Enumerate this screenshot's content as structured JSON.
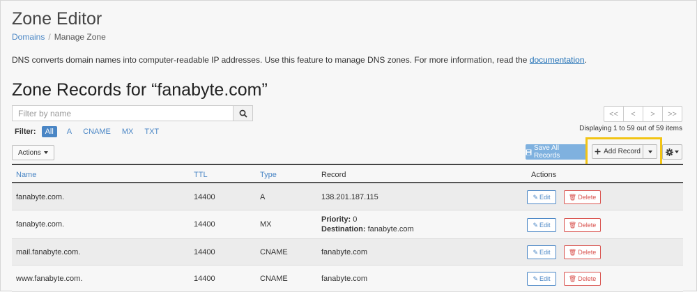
{
  "page_title": "Zone Editor",
  "breadcrumb": {
    "parent": "Domains",
    "separator": "/",
    "current": "Manage Zone"
  },
  "description": {
    "text": "DNS converts domain names into computer-readable IP addresses. Use this feature to manage DNS zones. For more information, read the ",
    "link": "documentation",
    "end": "."
  },
  "section_title": "Zone Records for “fanabyte.com”",
  "search": {
    "placeholder": "Filter by name"
  },
  "filter": {
    "label": "Filter:",
    "options": [
      "All",
      "A",
      "CNAME",
      "MX",
      "TXT"
    ],
    "active": "All"
  },
  "pagination": {
    "first": "<<",
    "prev": "<",
    "next": ">",
    "last": ">>",
    "display": "Displaying 1 to 59 out of 59 items"
  },
  "toolbar": {
    "actions_label": "Actions",
    "save_all_label": "Save All Records",
    "add_record_label": "Add Record"
  },
  "table": {
    "headers": {
      "name": "Name",
      "ttl": "TTL",
      "type": "Type",
      "record": "Record",
      "actions": "Actions"
    },
    "rows": [
      {
        "name": "fanabyte.com.",
        "ttl": "14400",
        "type": "A",
        "record": "138.201.187.115"
      },
      {
        "name": "fanabyte.com.",
        "ttl": "14400",
        "type": "MX",
        "priority_label": "Priority:",
        "priority": "0",
        "destination_label": "Destination:",
        "destination": "fanabyte.com"
      },
      {
        "name": "mail.fanabyte.com.",
        "ttl": "14400",
        "type": "CNAME",
        "record": "fanabyte.com"
      },
      {
        "name": "www.fanabyte.com.",
        "ttl": "14400",
        "type": "CNAME",
        "record": "fanabyte.com"
      }
    ],
    "edit_label": "Edit",
    "delete_label": "Delete"
  },
  "colors": {
    "link": "#4a86c5",
    "highlight": "#f2c414",
    "danger": "#d9534f",
    "primary_light": "#7fb1df"
  }
}
